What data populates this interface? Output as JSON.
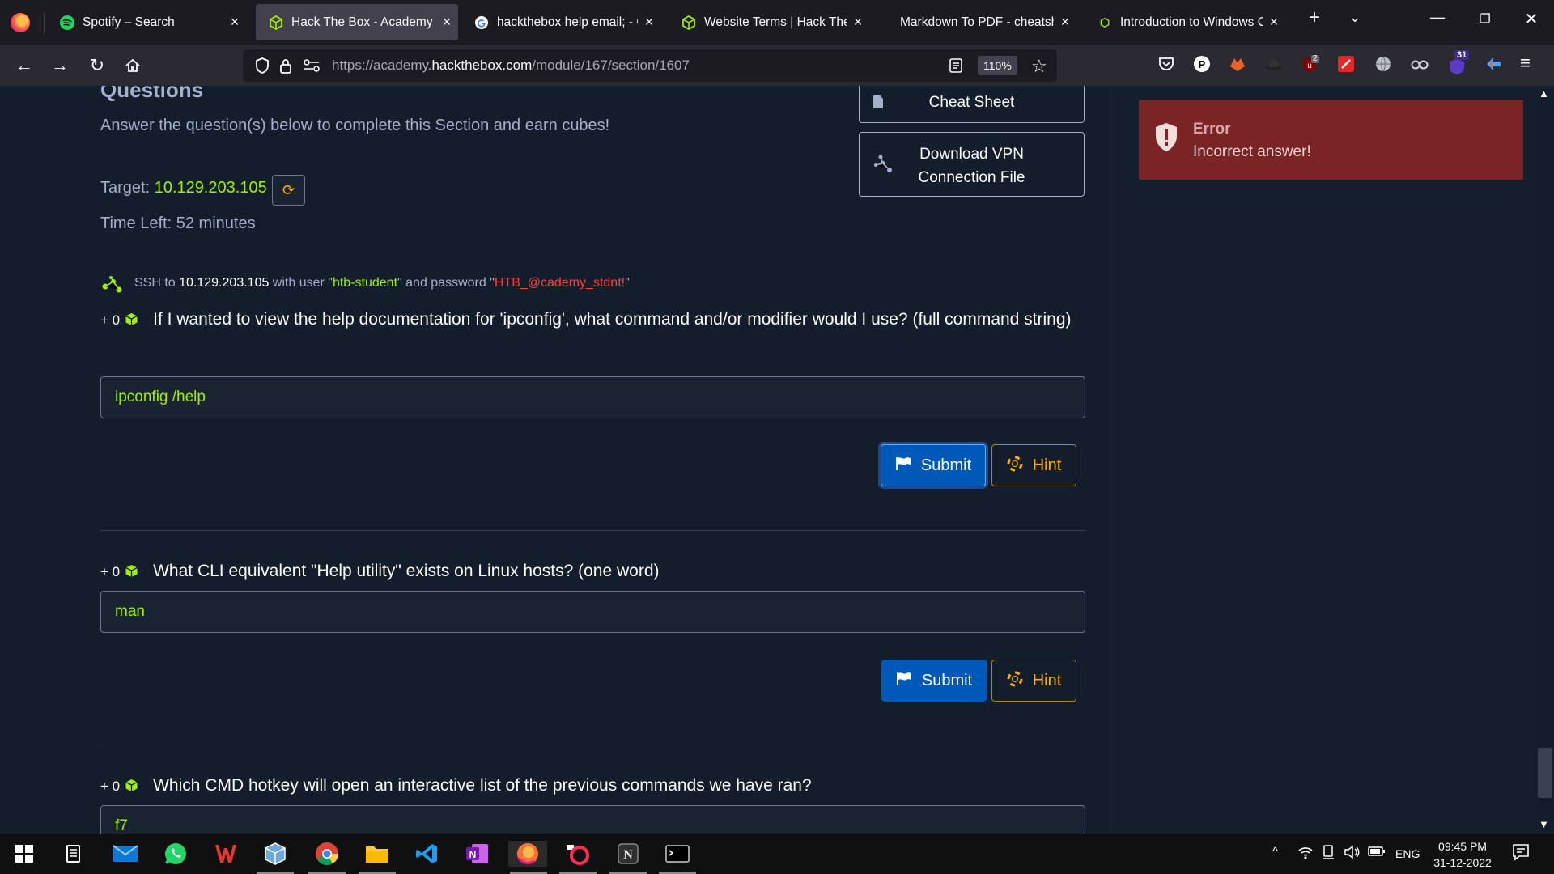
{
  "browser": {
    "tabs": [
      {
        "title": "Spotify – Search",
        "icon": "spotify-icon"
      },
      {
        "title": "Hack The Box - Academy",
        "icon": "htb-cube-icon",
        "active": true
      },
      {
        "title": "hackthebox help email; - Go",
        "icon": "google-icon"
      },
      {
        "title": "Website Terms | Hack The Bo",
        "icon": "htb-cube-icon"
      },
      {
        "title": "Markdown To PDF - cheatsheet",
        "icon": "none"
      },
      {
        "title": "Introduction to Windows Co",
        "icon": "htb-cube-icon"
      }
    ],
    "url_prefix": "https://academy.",
    "url_domain": "hackthebox.com",
    "url_suffix": "/module/167/section/1607",
    "zoom": "110%",
    "ext_badge_ublock": "2",
    "ext_badge_counter": "31"
  },
  "page": {
    "questions_heading": "Questions",
    "intro": "Answer the question(s) below to complete this Section and earn cubes!",
    "target_label": "Target: ",
    "target_ip": "10.129.203.105",
    "time_left": "Time Left: 52 minutes",
    "ssh": {
      "prefix": "SSH to ",
      "ip": "10.129.203.105",
      "mid": " with user \"",
      "user": "htb-student",
      "mid2": "\" and password \"",
      "password": "HTB_@cademy_stdnt!",
      "end": "\""
    },
    "cheat_sheet_label": "Cheat Sheet",
    "vpn_label_1": "Download VPN",
    "vpn_label_2": "Connection File",
    "questions": [
      {
        "points": "+ 0",
        "text": "If I wanted to view the help documentation for 'ipconfig', what command and/or modifier would I use? (full command string)",
        "answer": "ipconfig /help"
      },
      {
        "points": "+ 0",
        "text": "What CLI equivalent \"Help utility\" exists on Linux hosts? (one word)",
        "answer": "man"
      },
      {
        "points": "+ 0",
        "text": "Which CMD hotkey will open an interactive list of the previous commands we have ran?",
        "answer": "f7"
      }
    ],
    "submit_label": "Submit",
    "hint_label": "Hint"
  },
  "toast": {
    "title": "Error",
    "message": "Incorrect answer!"
  },
  "taskbar": {
    "language": "ENG",
    "time": "09:45 PM",
    "date": "31-12-2022"
  },
  "colors": {
    "accent_green": "#9fef00",
    "submit_blue": "#0059b8",
    "hint_orange": "#ffaf00",
    "error_red": "#7a2425"
  }
}
